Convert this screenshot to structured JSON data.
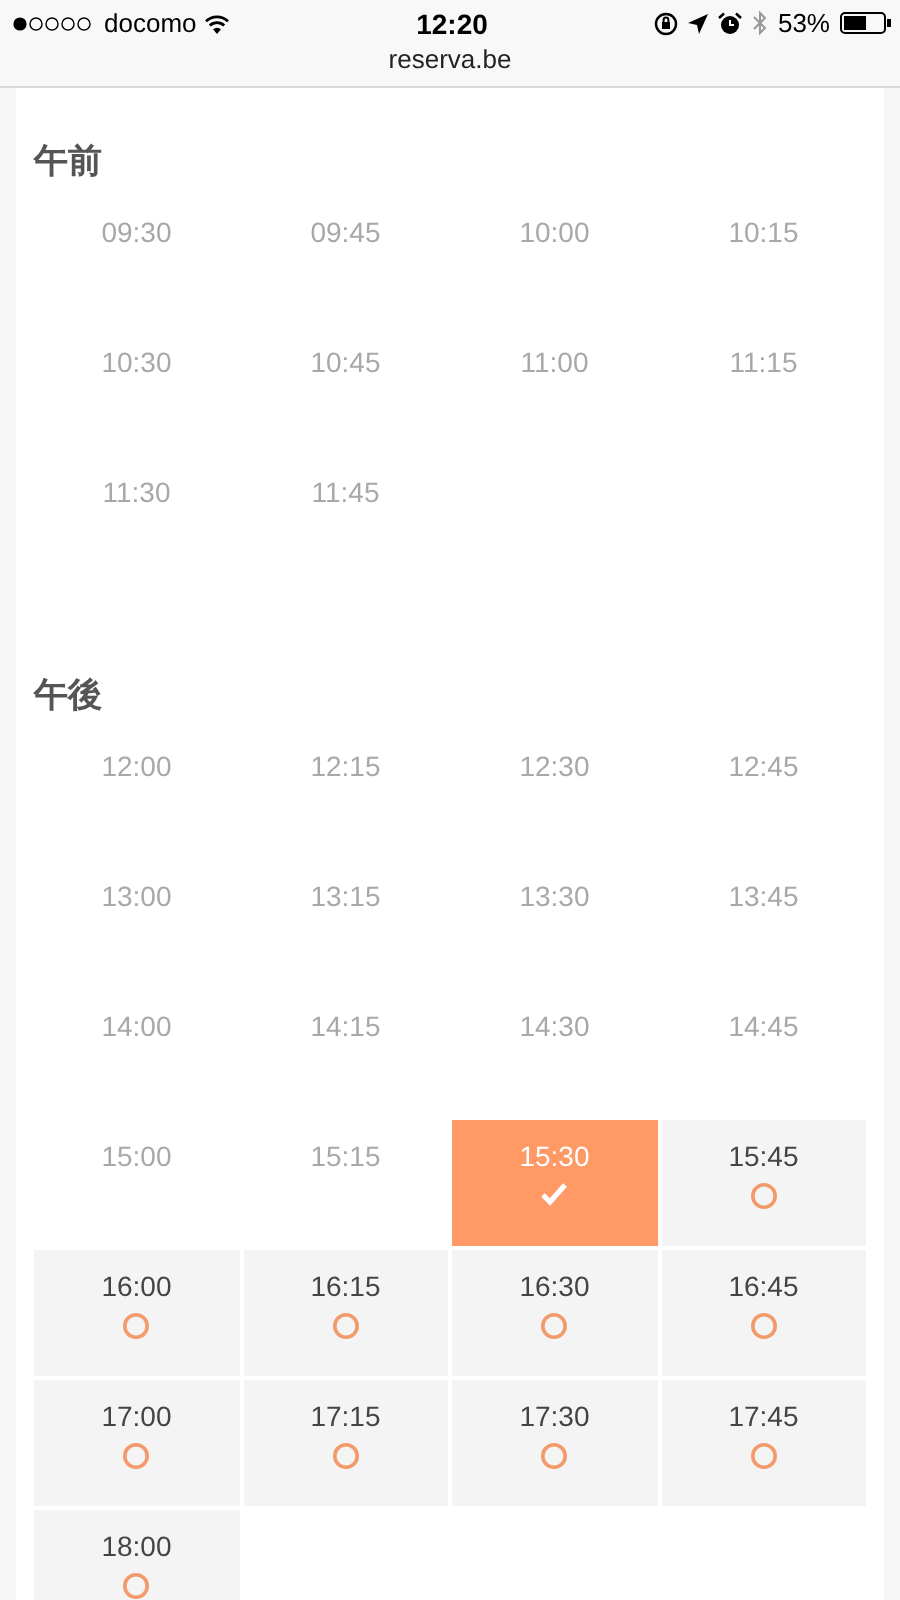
{
  "status_bar": {
    "carrier": "docomo",
    "time": "12:20",
    "battery": "53%"
  },
  "address_bar": {
    "url": "reserva.be"
  },
  "sections": [
    {
      "title": "午前",
      "slots": [
        {
          "time": "09:30",
          "available": false,
          "selected": false
        },
        {
          "time": "09:45",
          "available": false,
          "selected": false
        },
        {
          "time": "10:00",
          "available": false,
          "selected": false
        },
        {
          "time": "10:15",
          "available": false,
          "selected": false
        },
        {
          "time": "10:30",
          "available": false,
          "selected": false
        },
        {
          "time": "10:45",
          "available": false,
          "selected": false
        },
        {
          "time": "11:00",
          "available": false,
          "selected": false
        },
        {
          "time": "11:15",
          "available": false,
          "selected": false
        },
        {
          "time": "11:30",
          "available": false,
          "selected": false
        },
        {
          "time": "11:45",
          "available": false,
          "selected": false
        }
      ]
    },
    {
      "title": "午後",
      "slots": [
        {
          "time": "12:00",
          "available": false,
          "selected": false
        },
        {
          "time": "12:15",
          "available": false,
          "selected": false
        },
        {
          "time": "12:30",
          "available": false,
          "selected": false
        },
        {
          "time": "12:45",
          "available": false,
          "selected": false
        },
        {
          "time": "13:00",
          "available": false,
          "selected": false
        },
        {
          "time": "13:15",
          "available": false,
          "selected": false
        },
        {
          "time": "13:30",
          "available": false,
          "selected": false
        },
        {
          "time": "13:45",
          "available": false,
          "selected": false
        },
        {
          "time": "14:00",
          "available": false,
          "selected": false
        },
        {
          "time": "14:15",
          "available": false,
          "selected": false
        },
        {
          "time": "14:30",
          "available": false,
          "selected": false
        },
        {
          "time": "14:45",
          "available": false,
          "selected": false
        },
        {
          "time": "15:00",
          "available": false,
          "selected": false
        },
        {
          "time": "15:15",
          "available": false,
          "selected": false
        },
        {
          "time": "15:30",
          "available": true,
          "selected": true
        },
        {
          "time": "15:45",
          "available": true,
          "selected": false
        },
        {
          "time": "16:00",
          "available": true,
          "selected": false
        },
        {
          "time": "16:15",
          "available": true,
          "selected": false
        },
        {
          "time": "16:30",
          "available": true,
          "selected": false
        },
        {
          "time": "16:45",
          "available": true,
          "selected": false
        },
        {
          "time": "17:00",
          "available": true,
          "selected": false
        },
        {
          "time": "17:15",
          "available": true,
          "selected": false
        },
        {
          "time": "17:30",
          "available": true,
          "selected": false
        },
        {
          "time": "17:45",
          "available": true,
          "selected": false
        },
        {
          "time": "18:00",
          "available": true,
          "selected": false
        }
      ]
    }
  ]
}
